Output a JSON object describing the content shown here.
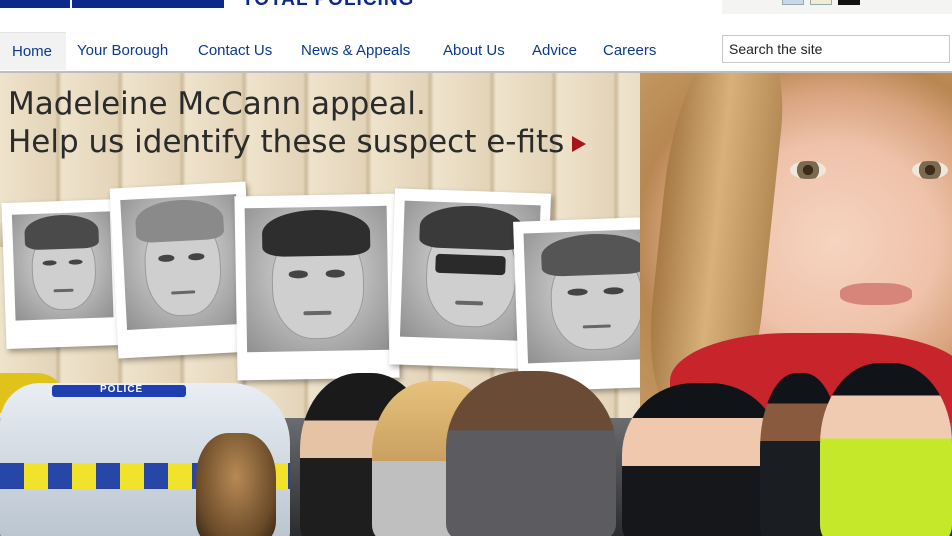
{
  "header": {
    "logo_text": "TOTAL POLICING"
  },
  "nav": {
    "items": [
      {
        "label": "Home"
      },
      {
        "label": "Your Borough"
      },
      {
        "label": "Contact Us"
      },
      {
        "label": "News & Appeals"
      },
      {
        "label": "About Us"
      },
      {
        "label": "Advice"
      },
      {
        "label": "Careers"
      }
    ],
    "search": {
      "placeholder": "Search the site"
    }
  },
  "banner": {
    "headline_line1": "Madeleine McCann appeal.",
    "headline_line2": "Help us identify these suspect e-fits",
    "arrow_icon": "play-arrow-icon",
    "police_car_label": "POLICE",
    "colors": {
      "accent_arrow": "#a8141c",
      "nav_text": "#0b3b8c",
      "logo_blue": "#0c2a8c"
    }
  }
}
